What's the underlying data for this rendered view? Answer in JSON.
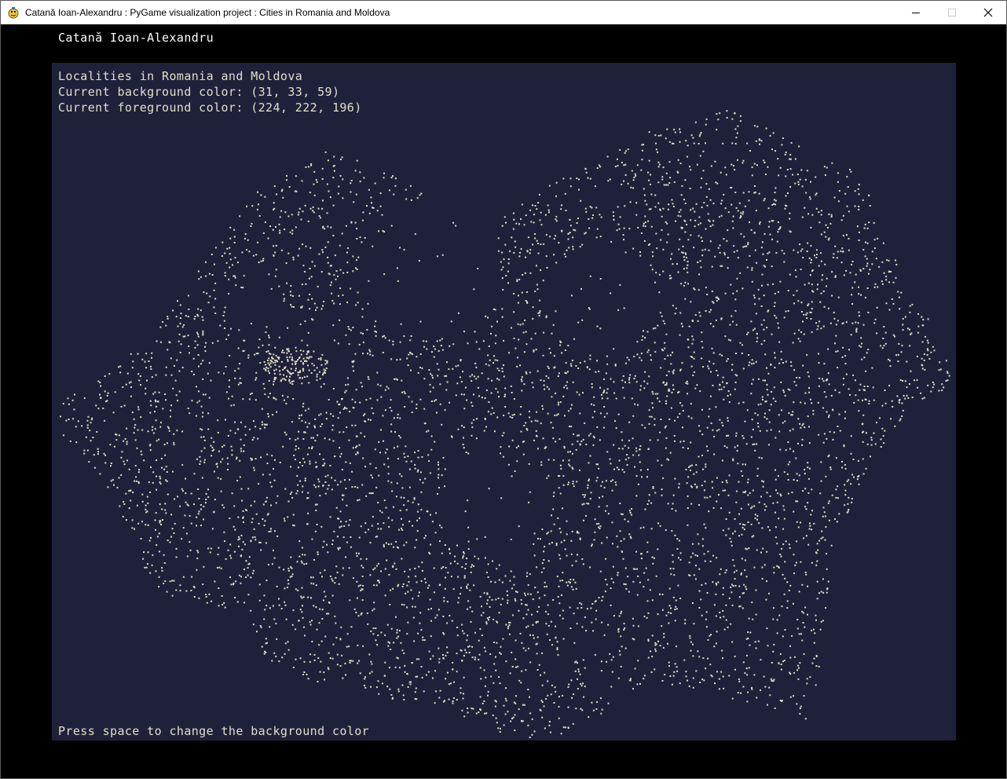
{
  "window": {
    "title": "Catană Ioan-Alexandru : PyGame visualization project : Cities in Romania and Moldova",
    "app_icon": "pygame-snake-icon",
    "controls": [
      "minimize-icon",
      "maximize-icon",
      "close-icon"
    ]
  },
  "author": "Catană Ioan-Alexandru",
  "canvas": {
    "heading": "Localities in Romania and Moldova",
    "background_label": "Current background color: (31, 33, 59)",
    "foreground_label": "Current foreground color: (224, 222, 196)",
    "hint": "Press space to change the background color",
    "background_color": "#1f213b",
    "foreground_color": "#e0dec4",
    "outer_background_color": "#000000"
  }
}
